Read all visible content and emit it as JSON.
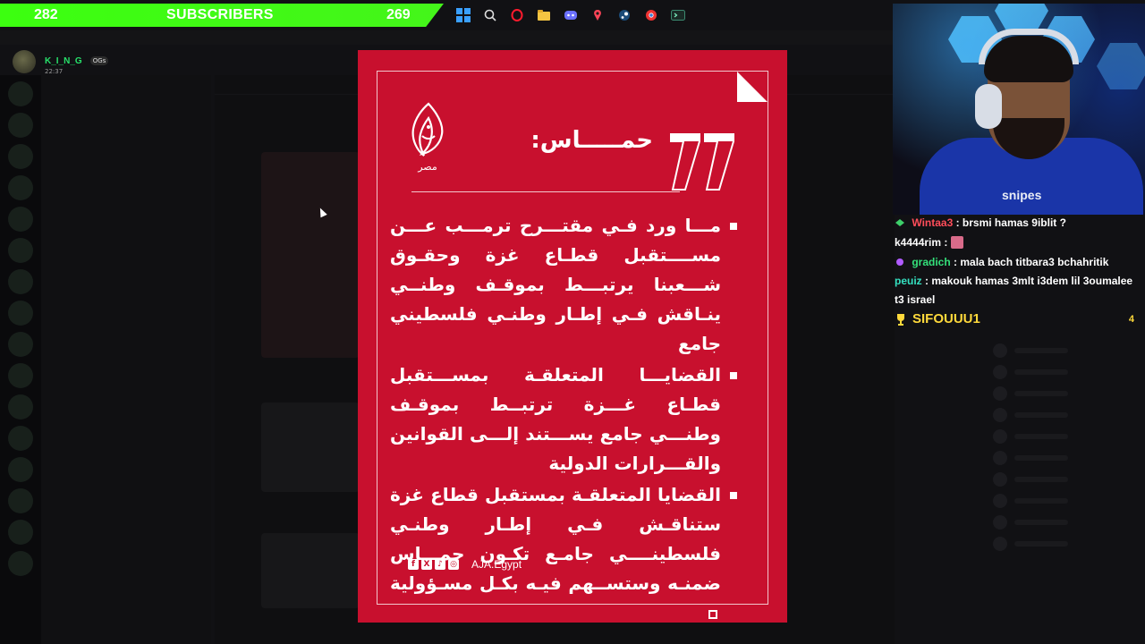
{
  "subscriber_bar": {
    "left_count": "282",
    "label": "SUBSCRIBERS",
    "right_count": "269"
  },
  "taskbar": {
    "icons": [
      "windows-start-icon",
      "search-icon",
      "opera-icon",
      "file-explorer-icon",
      "discord-icon",
      "location-pin-icon",
      "steam-icon",
      "chrome-icon",
      "terminal-icon"
    ]
  },
  "top_message": {
    "username": "K_I_N_G",
    "badge": "OGs",
    "timestamp": "22:37"
  },
  "poster": {
    "title": "حمـــــاس:",
    "logo_country": "مصر",
    "bullets": [
      "مـــا ورد فـي مقتـــرح ترمـــب عـــن مســــتقبل قطـاع غزة وحقـوق شـــعبنا يرتبـــط بموقـف وطنــي ينـاقش فـي إطـار وطنـي فلسطيني جامع",
      "القضايـــا المتعلقـة بمســـتقبل قطـاع غـــزة ترتبــط بموقـف وطنـــي جامع يســـتند إلـــى القوانين والقـــرارات الدولية",
      "القضايا المتعلقـة بمستقبل قطاع غزة ستناقـش فـي إطـار وطنـي فلسطينــــي جامـع تكـون حمـــاس ضمنـه وستســهم فيـه بكـل مسـؤولية"
    ],
    "handle": "AJA.Egypt",
    "colors": {
      "background": "#c8102e",
      "text": "#ffffff"
    }
  },
  "stream_chat": {
    "messages": [
      {
        "user": "Wintaa3",
        "user_color": "#ff4d5a",
        "text": ": brsmi hamas 9iblit ?"
      },
      {
        "user": "k4444rim",
        "user_color": "#ffffff",
        "text": ":"
      },
      {
        "user": "gradich",
        "user_color": "#34e07a",
        "text": ": mala bach titbara3 bchahritik"
      },
      {
        "user": "peuiz",
        "user_color": "#34e0c0",
        "text": ": makouk hamas 3mlt i3dem lil 3oumalee t3 israel"
      }
    ],
    "top_chatter": {
      "name": "SIFOUUU1",
      "count": "4"
    }
  }
}
